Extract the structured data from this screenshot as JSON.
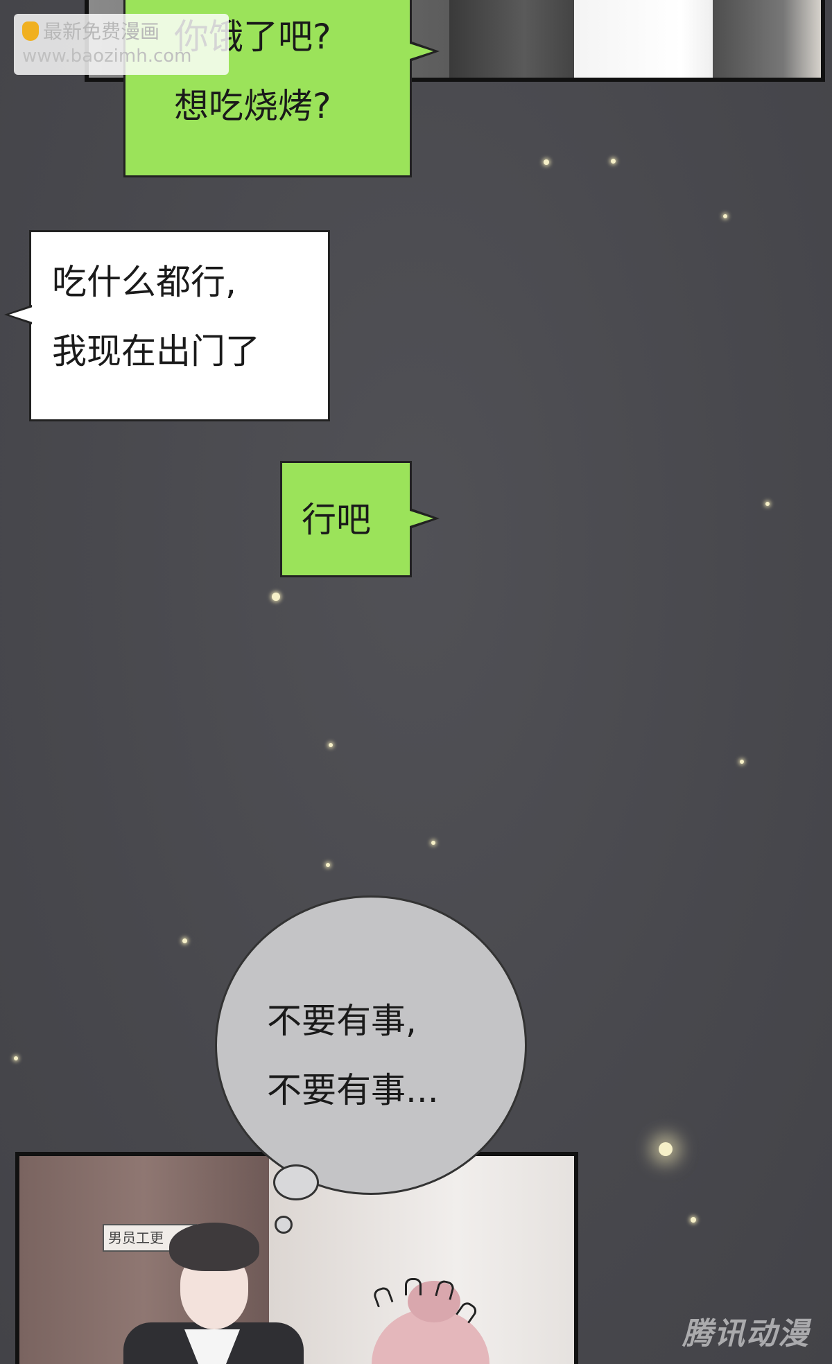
{
  "watermark": {
    "line1": "最新免费漫画",
    "line2": "www.baozimh.com"
  },
  "bubbles": [
    {
      "speaker": "green",
      "lines": [
        "你饿了吧?",
        "想吃烧烤?"
      ]
    },
    {
      "speaker": "white",
      "lines": [
        "吃什么都行,",
        "我现在出门了"
      ]
    },
    {
      "speaker": "green",
      "lines": [
        "行吧"
      ]
    }
  ],
  "thought": {
    "lines": [
      "不要有事,",
      "不要有事..."
    ]
  },
  "bottom_panel": {
    "door_sign": "男员工更"
  },
  "publisher": "腾讯动漫",
  "colors": {
    "background": "#4a4a4f",
    "green_bubble": "#9be35a",
    "white_bubble": "#ffffff",
    "thought_bubble": "#c4c4c6"
  }
}
